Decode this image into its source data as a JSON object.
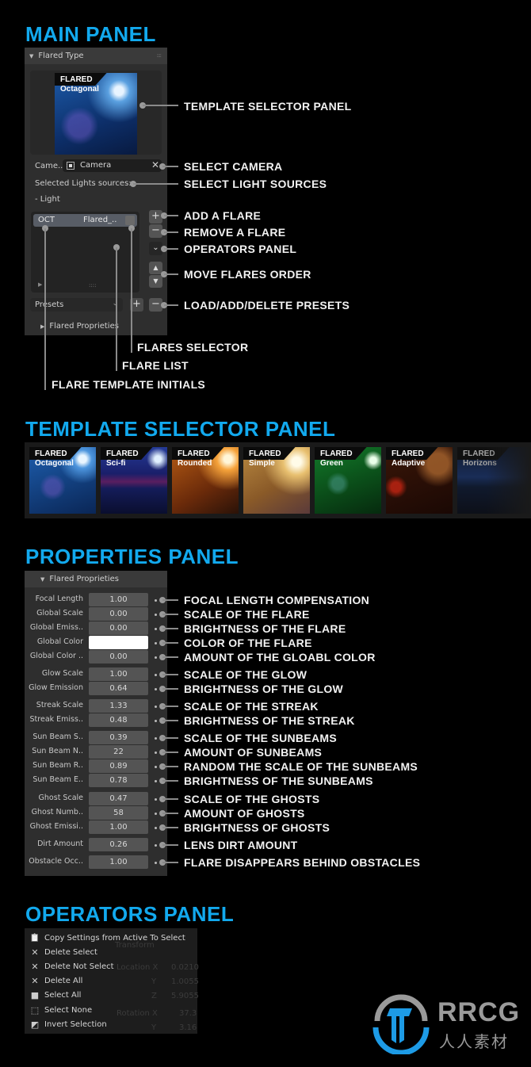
{
  "sections": {
    "main": "MAIN PANEL",
    "templates": "TEMPLATE SELECTOR PANEL",
    "properties": "PROPERTIES PANEL",
    "operators": "OPERATORS PANEL"
  },
  "main_panel": {
    "header": "Flared Type",
    "preview": {
      "brand": "FLARED",
      "name": "Octagonal"
    },
    "camera_label": "Came..",
    "camera_value": "Camera",
    "lights_label": "Selected Lights sources:",
    "lights_value": "- Light",
    "list_row": {
      "initials": "OCT",
      "name": "Flared_.."
    },
    "presets_label": "Presets",
    "sub_panel": "Flared Proprieties",
    "buttons": {
      "add": "+",
      "remove": "−",
      "operators": "⌄",
      "up": "▲",
      "down": "▼",
      "preset_add": "+",
      "preset_remove": "−"
    }
  },
  "main_callouts": {
    "template_selector": "TEMPLATE SELECTOR PANEL",
    "select_camera": "SELECT CAMERA",
    "select_lights": "SELECT LIGHT SOURCES",
    "add_flare": "ADD A FLARE",
    "remove_flare": "REMOVE A FLARE",
    "operators_panel": "OPERATORS PANEL",
    "move_order": "MOVE FLARES ORDER",
    "presets": "LOAD/ADD/DELETE PRESETS",
    "flares_selector": "FLARES SELECTOR",
    "flare_list": "FLARE LIST",
    "template_initials": "FLARE TEMPLATE INITIALS"
  },
  "templates": [
    {
      "brand": "FLARED",
      "name": "Octagonal"
    },
    {
      "brand": "FLARED",
      "name": "Sci-fi"
    },
    {
      "brand": "FLARED",
      "name": "Rounded"
    },
    {
      "brand": "FLARED",
      "name": "Simple"
    },
    {
      "brand": "FLARED",
      "name": "Green"
    },
    {
      "brand": "FLARED",
      "name": "Adaptive"
    },
    {
      "brand": "FLARED",
      "name": "Horizons"
    }
  ],
  "properties_panel": {
    "header": "Flared Proprieties",
    "rows": [
      {
        "label": "Focal Length",
        "value": "1.00",
        "desc": "FOCAL LENGTH COMPENSATION"
      },
      {
        "label": "Global Scale",
        "value": "0.00",
        "desc": "SCALE OF THE FLARE"
      },
      {
        "label": "Global Emiss..",
        "value": "0.00",
        "desc": "BRIGHTNESS OF THE FLARE"
      },
      {
        "label": "Global Color",
        "value": "",
        "desc": "COLOR OF THE FLARE",
        "color": "#ffffff"
      },
      {
        "label": "Global Color ..",
        "value": "0.00",
        "desc": "AMOUNT OF THE GLOABL COLOR"
      },
      {
        "label": "Glow Scale",
        "value": "1.00",
        "desc": "SCALE OF THE GLOW"
      },
      {
        "label": "Glow Emission",
        "value": "0.64",
        "desc": "BRIGHTNESS OF THE GLOW"
      },
      {
        "label": "Streak Scale",
        "value": "1.33",
        "desc": "SCALE OF THE STREAK"
      },
      {
        "label": "Streak Emiss..",
        "value": "0.48",
        "desc": "BRIGHTNESS OF THE STREAK"
      },
      {
        "label": "Sun Beam S..",
        "value": "0.39",
        "desc": "SCALE OF THE SUNBEAMS"
      },
      {
        "label": "Sun Beam N..",
        "value": "22",
        "desc": "AMOUNT OF SUNBEAMS"
      },
      {
        "label": "Sun Beam R..",
        "value": "0.89",
        "desc": "RANDOM THE SCALE OF THE SUNBEAMS"
      },
      {
        "label": "Sun Beam E..",
        "value": "0.78",
        "desc": "BRIGHTNESS OF THE SUNBEAMS"
      },
      {
        "label": "Ghost Scale",
        "value": "0.47",
        "desc": "SCALE OF THE GHOSTS"
      },
      {
        "label": "Ghost Numb..",
        "value": "58",
        "desc": "AMOUNT OF GHOSTS"
      },
      {
        "label": "Ghost Emissi..",
        "value": "1.00",
        "desc": "BRIGHTNESS OF GHOSTS"
      },
      {
        "label": "Dirt Amount",
        "value": "0.26",
        "desc": "LENS DIRT AMOUNT"
      },
      {
        "label": "Obstacle Occ..",
        "value": "1.00",
        "desc": "FLARE DISAPPEARS BEHIND OBSTACLES"
      }
    ]
  },
  "operators_menu": [
    {
      "icon": "clipboard-copy",
      "label": "Copy Settings from Active To Select"
    },
    {
      "icon": "x",
      "label": "Delete Select"
    },
    {
      "icon": "x",
      "label": "Delete Not Select"
    },
    {
      "icon": "x",
      "label": "Delete All"
    },
    {
      "icon": "select-all",
      "label": "Select All"
    },
    {
      "icon": "select-none",
      "label": "Select None"
    },
    {
      "icon": "invert-selection",
      "label": "Invert Selection"
    }
  ],
  "background_ghost": [
    "Transform",
    "Location X",
    "Y",
    "Z",
    "Rotation X",
    "Y",
    "0.0210",
    "1.0055",
    "5.9055",
    "37.3",
    "3.16"
  ],
  "watermark": {
    "brand": "RRCG",
    "sub": "人人素材",
    "colors": {
      "blue": "#1d9be6",
      "gray": "#9a9a9a"
    }
  }
}
